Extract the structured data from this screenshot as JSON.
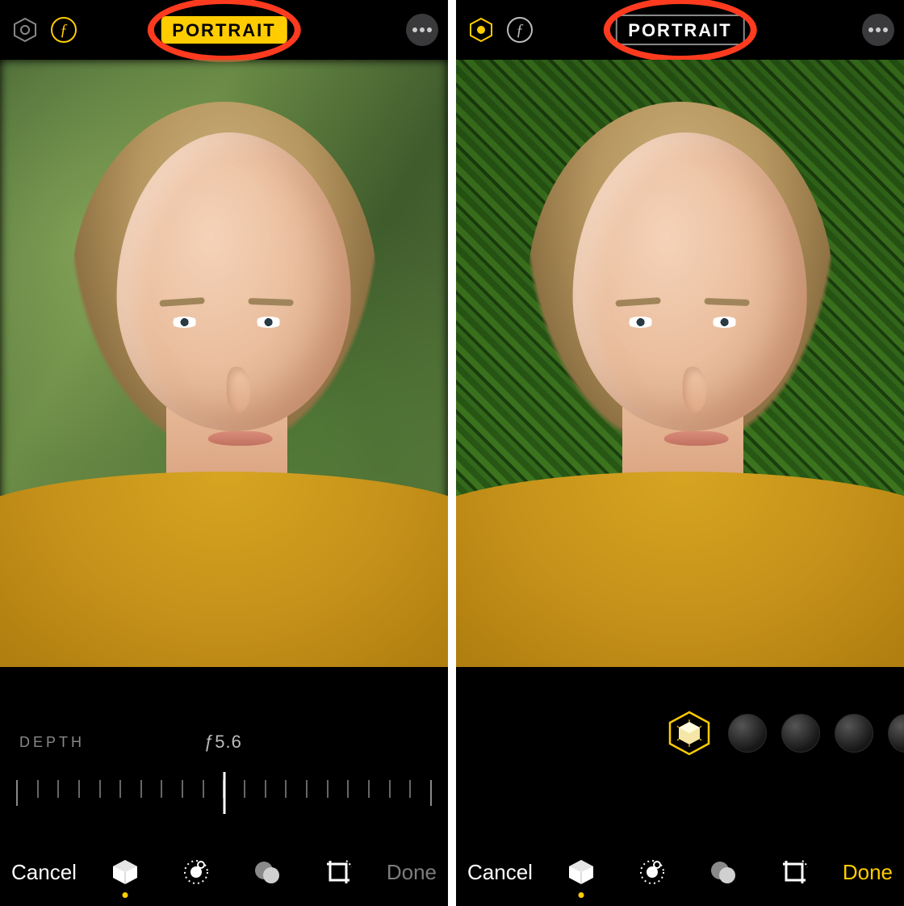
{
  "colors": {
    "accent": "#ffcc00",
    "annotation": "#ff3b1f",
    "dim": "#7d7d7d"
  },
  "icons": {
    "lighting": "portrait-lighting-icon",
    "aperture": "f-stop-icon",
    "more": "more-icon",
    "portrait_tool": "portrait-cube-icon",
    "adjust_tool": "adjust-dial-icon",
    "filter_tool": "filters-circles-icon",
    "crop_tool": "crop-rotate-icon"
  },
  "left": {
    "portrait_badge": "PORTRAIT",
    "portrait_active": true,
    "depth_label": "DEPTH",
    "depth_value": "ƒ5.6",
    "ruler_ticks": 21,
    "ruler_cursor_index": 10,
    "cancel_label": "Cancel",
    "done_label": "Done",
    "done_enabled": false,
    "active_tool": "portrait"
  },
  "right": {
    "portrait_badge": "PORTRAIT",
    "portrait_active": false,
    "lighting_options_visible": 5,
    "lighting_selected_index": 0,
    "cancel_label": "Cancel",
    "done_label": "Done",
    "done_enabled": true,
    "active_tool": "portrait"
  }
}
